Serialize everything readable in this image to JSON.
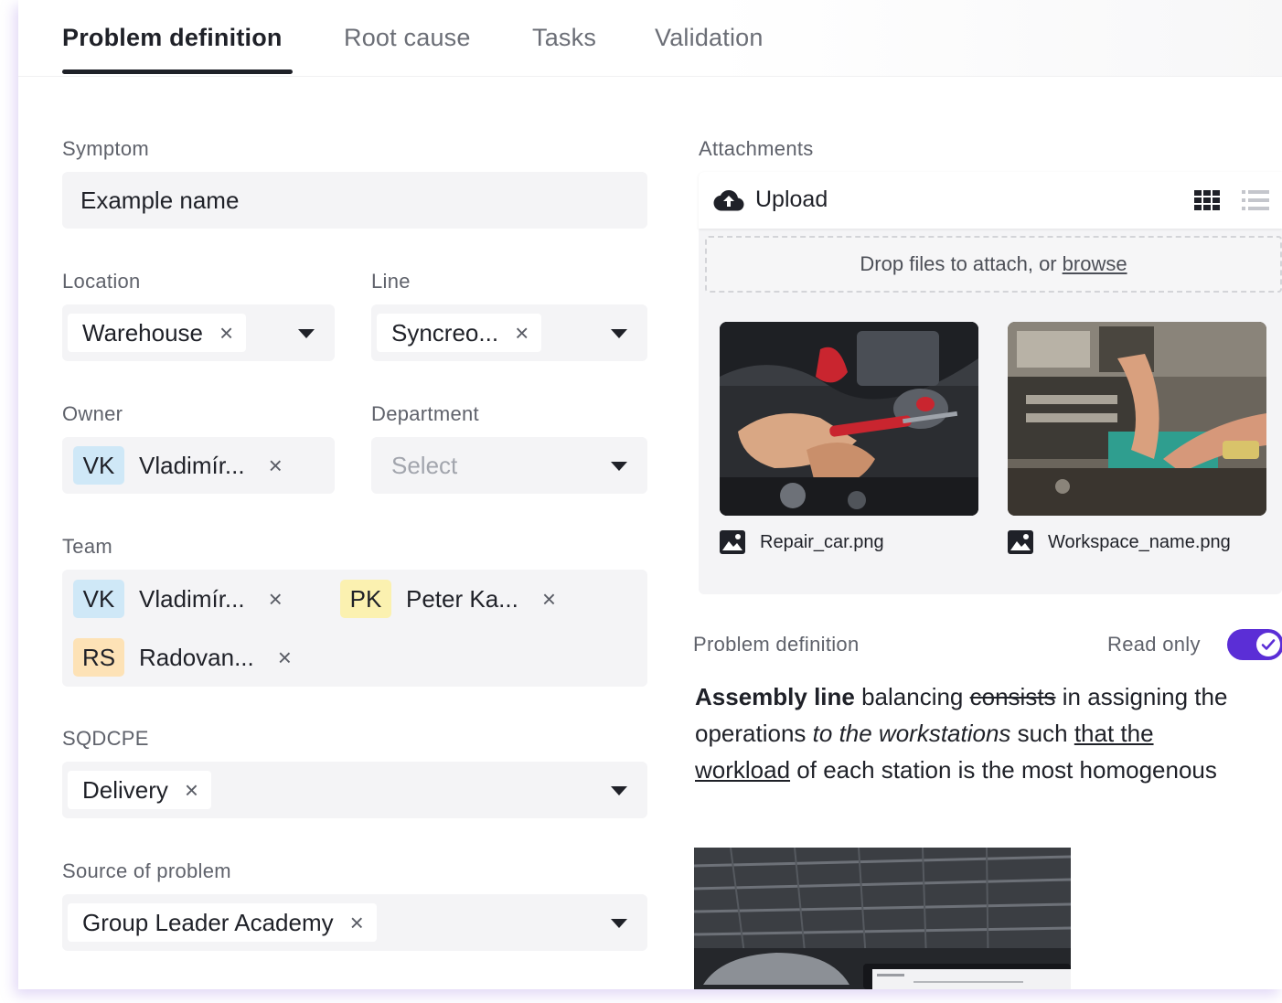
{
  "tabs": [
    {
      "label": "Problem definition",
      "active": true
    },
    {
      "label": "Root cause"
    },
    {
      "label": "Tasks"
    },
    {
      "label": "Validation"
    }
  ],
  "symptom": {
    "label": "Symptom",
    "value": "Example name"
  },
  "location": {
    "label": "Location",
    "chip": "Warehouse"
  },
  "line": {
    "label": "Line",
    "chip": "Syncreo..."
  },
  "owner": {
    "label": "Owner",
    "initials": "VK",
    "name": "Vladimír..."
  },
  "department": {
    "label": "Department",
    "placeholder": "Select"
  },
  "team": {
    "label": "Team",
    "members": [
      {
        "initials": "VK",
        "name": "Vladimír..."
      },
      {
        "initials": "PK",
        "name": "Peter Ka..."
      },
      {
        "initials": "RS",
        "name": "Radovan..."
      }
    ]
  },
  "sqdcpe": {
    "label": "SQDCPE",
    "chip": "Delivery"
  },
  "source": {
    "label": "Source of problem",
    "chip": "Group Leader Academy"
  },
  "attachments": {
    "label": "Attachments",
    "upload_label": "Upload",
    "drop_text": "Drop files to attach, or",
    "browse": "browse",
    "files": [
      {
        "name": "Repair_car.png"
      },
      {
        "name": "Workspace_name.png"
      }
    ]
  },
  "problem_definition": {
    "label": "Problem definition",
    "read_only_label": "Read only",
    "read_only": true,
    "rich_text": {
      "bold": "Assembly line",
      "t1": " balancing ",
      "strike": "consists",
      "t2": " in assigning the operations ",
      "italic": "to the workstations",
      "t3": " such ",
      "underline": "that the workload",
      "t4": " of each station is the most homogenous"
    }
  },
  "close_symbol": "×",
  "colors": {
    "accent": "#5b2ed6",
    "avatar_vk": "#cfe8f7",
    "avatar_pk": "#fbf1b0",
    "avatar_rs": "#fde2b6"
  }
}
